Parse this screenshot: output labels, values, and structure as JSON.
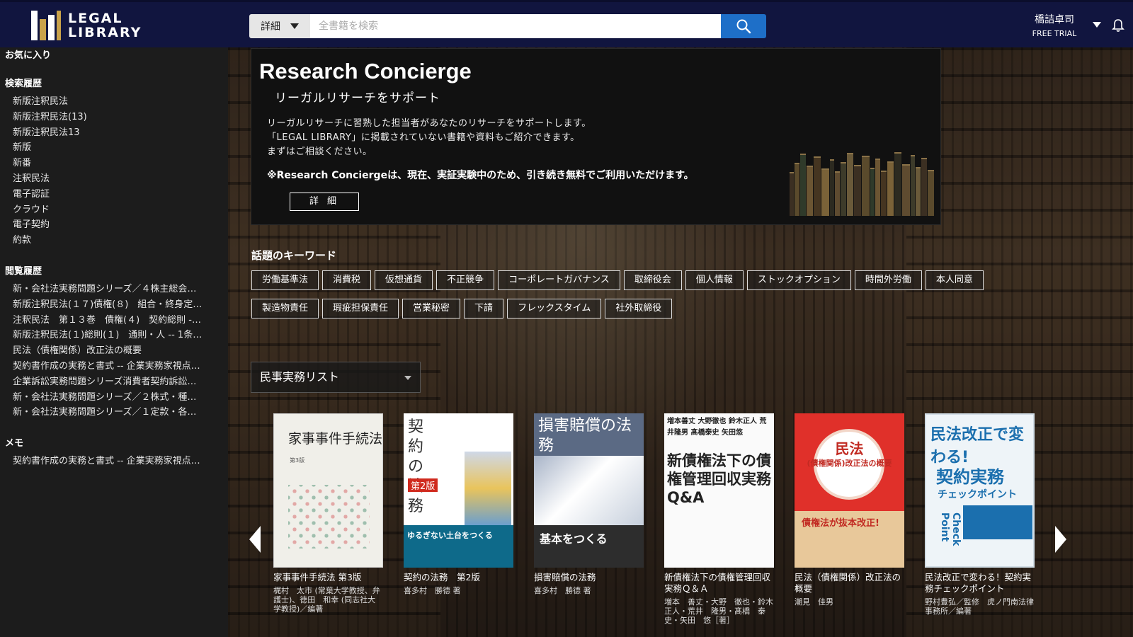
{
  "header": {
    "logo_line1": "LEGAL",
    "logo_line2": "LIBRARY",
    "search_scope": "詳細",
    "search_placeholder": "全書籍を検索",
    "user_name": "橋詰卓司",
    "user_plan": "FREE TRIAL"
  },
  "sidebar": {
    "favorites_heading": "お気に入り",
    "search_history_heading": "検索履歴",
    "search_history": [
      "新版注釈民法",
      "新版注釈民法(13)",
      "新版注釈民法13",
      "新版",
      "新番",
      "注釈民法",
      "電子認証",
      "クラウド",
      "電子契約",
      "約款"
    ],
    "view_history_heading": "閲覧履歴",
    "view_history": [
      "新・会社法実務問題シリーズ／４株主総会…",
      "新版注釈民法(１７)債権(８)　組合・終身定…",
      "注釈民法　第１３巻　債権(４)　契約総則 -…",
      "新版注釈民法(１)総則(１)　通則・人 -- 1条…",
      "民法（債権関係）改正法の概要",
      "契約書作成の実務と書式 -- 企業実務家視点…",
      "企業訴訟実務問題シリーズ消費者契約訴訟…",
      "新・会社法実務問題シリーズ／２株式・種…",
      "新・会社法実務問題シリーズ／１定款・各…"
    ],
    "memo_heading": "メモ",
    "memos": [
      "契約書作成の実務と書式 -- 企業実務家視点…"
    ]
  },
  "concierge": {
    "title": "Research Concierge",
    "subtitle": "リーガルリサーチをサポート",
    "body_lines": [
      "リーガルリサーチに習熟した担当者があなたのリサーチをサポートします。",
      "「LEGAL LIBRARY」に掲載されていない書籍や資料もご紹介できます。",
      "まずはご相談ください。"
    ],
    "note": "※Research Conciergeは、現在、実証実験中のため、引き続き無料でご利用いただけます。",
    "button": "詳 細"
  },
  "keywords": {
    "heading": "話題のキーワード",
    "items": [
      "労働基準法",
      "消費税",
      "仮想通貨",
      "不正競争",
      "コーポレートガバナンス",
      "取締役会",
      "個人情報",
      "ストックオプション",
      "時間外労働",
      "本人同意",
      "製造物責任",
      "瑕疵担保責任",
      "営業秘密",
      "下請",
      "フレックスタイム",
      "社外取締役"
    ]
  },
  "list_select": "民事実務リスト",
  "books": [
    {
      "title": "家事事件手続法 第3版",
      "author": "梶村　太市 (常葉大学教授、弁護士)、徳田　和幸 (同志社大学教授)／編著",
      "cover_title": "家事事件手続法",
      "cover_sub": "第3版"
    },
    {
      "title": "契約の法務　第2版",
      "author": "喜多村　勝德 著",
      "cover_title": "契約の法務",
      "cover_edition": "第2版",
      "cover_band": "ゆるぎない土台をつくる"
    },
    {
      "title": "損害賠償の法務",
      "author": "喜多村　勝德 著",
      "cover_title": "損害賠償の法務",
      "cover_band": "基本をつくる"
    },
    {
      "title": "新債権法下の債権管理回収実務Ｑ＆Ａ",
      "author": "増本　善丈・大野　徹也・鈴木　正人・荒井　隆男・髙橋　泰史・矢田　悠［著］",
      "cover_names": "増本善丈 大野徹也 鈴木正人 荒井隆男 髙橋泰史 矢田悠",
      "cover_title": "新債権法下の債権管理回収実務Q&A"
    },
    {
      "title": "民法（債権関係）改正法の概要",
      "author": "潮見　佳男",
      "cover_title": "民法",
      "cover_sub": "(債権関係)改正法の概要",
      "cover_band": "債権法が抜本改正!"
    },
    {
      "title": "民法改正で変わる！契約実務チェックポイント",
      "author": "野村豊弘／監修　虎ノ門南法律事務所／編著",
      "cover_title": "民法改正で変わる!",
      "cover_t2": "契約実務",
      "cover_t3": "チェックポイント",
      "cover_cp": "Check Point"
    }
  ],
  "colors": {
    "header_bg": "#11153f",
    "search_button": "#1e6fc8",
    "logo_gold": "#c9a24a"
  }
}
